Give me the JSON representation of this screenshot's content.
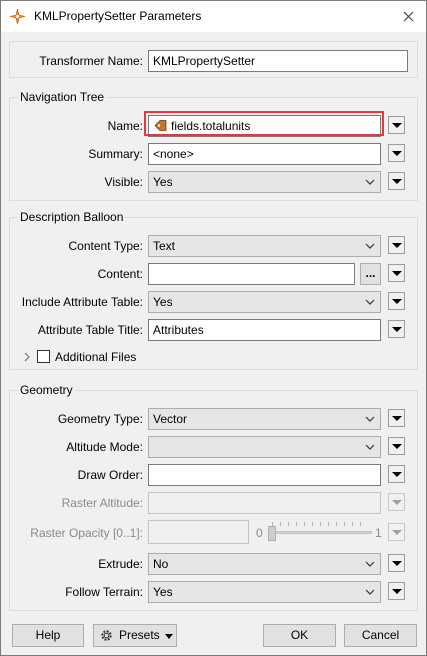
{
  "window": {
    "title": "KMLPropertySetter Parameters"
  },
  "transformer": {
    "label": "Transformer Name:",
    "value": "KMLPropertySetter"
  },
  "navigation_tree": {
    "title": "Navigation Tree",
    "name": {
      "label": "Name:",
      "value": "fields.totalunits"
    },
    "summary": {
      "label": "Summary:",
      "value": "<none>"
    },
    "visible": {
      "label": "Visible:",
      "value": "Yes"
    }
  },
  "description_balloon": {
    "title": "Description Balloon",
    "content_type": {
      "label": "Content Type:",
      "value": "Text"
    },
    "content": {
      "label": "Content:",
      "value": "",
      "ellipsis": "..."
    },
    "include_attribute_table": {
      "label": "Include Attribute Table:",
      "value": "Yes"
    },
    "attribute_table_title": {
      "label": "Attribute Table Title:",
      "value": "Attributes"
    },
    "additional_files": {
      "label": "Additional Files",
      "checked": false
    }
  },
  "geometry": {
    "title": "Geometry",
    "geometry_type": {
      "label": "Geometry Type:",
      "value": "Vector"
    },
    "altitude_mode": {
      "label": "Altitude Mode:",
      "value": ""
    },
    "draw_order": {
      "label": "Draw Order:",
      "value": ""
    },
    "raster_altitude": {
      "label": "Raster Altitude:",
      "value": ""
    },
    "raster_opacity": {
      "label": "Raster Opacity [0..1]:",
      "value": "",
      "min": "0",
      "max": "1",
      "level": 0
    },
    "extrude": {
      "label": "Extrude:",
      "value": "No"
    },
    "follow_terrain": {
      "label": "Follow Terrain:",
      "value": "Yes"
    }
  },
  "footer": {
    "help": "Help",
    "presets": "Presets",
    "ok": "OK",
    "cancel": "Cancel"
  },
  "colors": {
    "highlight": "#e0393e",
    "attribute_icon": "#c4772a"
  }
}
